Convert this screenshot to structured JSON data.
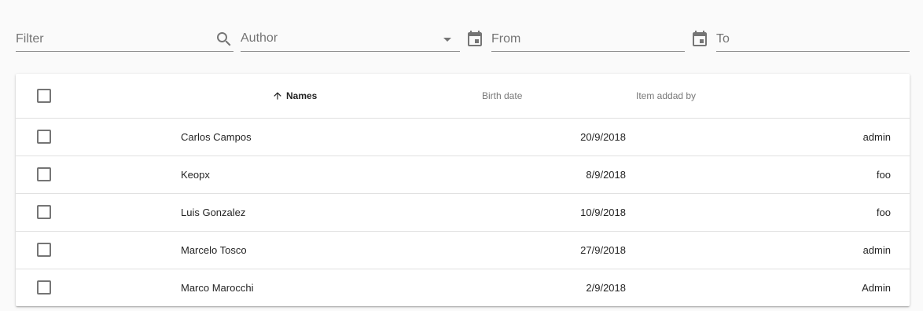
{
  "filters": {
    "filter_placeholder": "Filter",
    "author_placeholder": "Author",
    "from_placeholder": "From",
    "to_placeholder": "To"
  },
  "table": {
    "headers": {
      "names": "Names",
      "birth_date": "Birth date",
      "added_by": "Item addad by"
    },
    "sort": {
      "column": "names",
      "direction": "ascending"
    },
    "rows": [
      {
        "name": "Carlos Campos",
        "birth_date": "20/9/2018",
        "added_by": "admin"
      },
      {
        "name": "Keopx",
        "birth_date": "8/9/2018",
        "added_by": "foo"
      },
      {
        "name": "Luis Gonzalez",
        "birth_date": "10/9/2018",
        "added_by": "foo"
      },
      {
        "name": "Marcelo Tosco",
        "birth_date": "27/9/2018",
        "added_by": "admin"
      },
      {
        "name": "Marco Marocchi",
        "birth_date": "2/9/2018",
        "added_by": "Admin"
      }
    ]
  },
  "icons": {
    "search": "search-icon",
    "dropdown": "arrow-drop-down-icon",
    "calendar": "calendar-icon",
    "sort": "arrow-upward-icon"
  },
  "colors": {
    "background": "#fafafa",
    "card": "#ffffff",
    "icon": "#757575"
  }
}
